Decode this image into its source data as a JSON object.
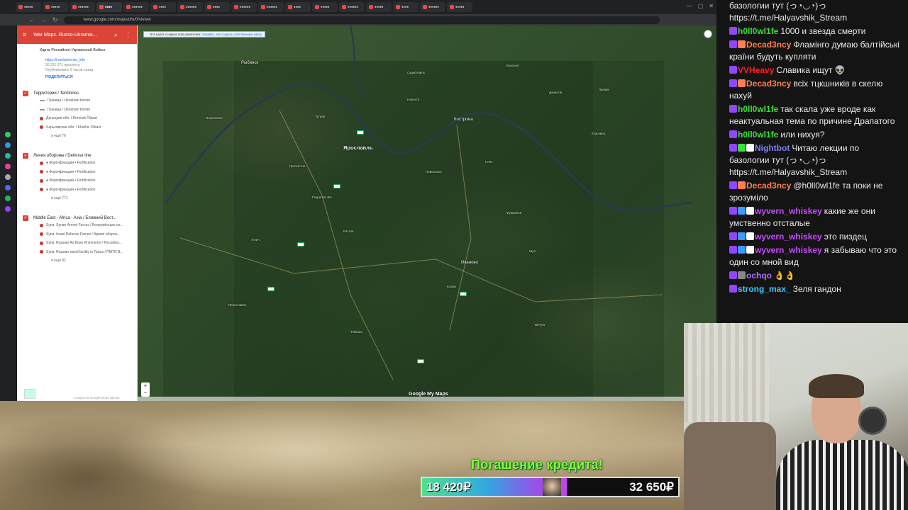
{
  "browser": {
    "tabs": [
      "▪▪▪▪▪",
      "▪▪▪▪▪",
      "▪▪▪▪▪▪",
      "▪▪▪▪",
      "▪▪▪▪▪▪",
      "▪▪▪▪",
      "▪▪▪▪▪▪",
      "▪▪▪▪",
      "▪▪▪▪▪▪",
      "▪▪▪▪▪▪",
      "▪▪▪▪",
      "▪▪▪▪▪",
      "▪▪▪▪▪▪",
      "▪▪▪▪▪",
      "▪▪▪▪",
      "▪▪▪▪▪▪",
      "▪▪▪▪▪"
    ],
    "url": "www.google.com/maps/d/u/0/viewer"
  },
  "maps_panel": {
    "title": "War Maps. Russo-Ukrainia...",
    "map_name": "Карта Российско-Украинской Войны",
    "info_link": "https://t.me/pshenka_info",
    "views": "30 231 071 просмотр",
    "published": "Опубликовано 9 часов назад",
    "share_label": "ПОДЕЛИТЬСЯ",
    "layers": [
      {
        "name": "Территории / Territories",
        "items": [
          "Граница / Ukrainian border",
          "Граница / Ukrainian border",
          "Донецкая обл. / Donetsk Oblast",
          "Харьковская обл. / Kharkiv Oblast"
        ],
        "more": "и ещё 70"
      },
      {
        "name": "Линия обороны / Defense line",
        "items": [
          "● Фортификация • Fortification",
          "● Фортификация • Fortification",
          "● Фортификация • Fortification",
          "● Фортификация • Fortification"
        ],
        "more": "и ещё 771"
      },
      {
        "name": "Middle East - Africa - Asia / Ближний Вост...",
        "items": [
          "Syria: Syrian Armed Forces / Вооружённые си...",
          "Syria: Israel Defense Forces / Армия оборон...",
          "Syria: Russian Air Base Khmeimim / Российск...",
          "Syria: Russian naval facility in Tartus / ПМТО В..."
        ],
        "more": "и ещё 82"
      }
    ],
    "footer": "Создано в Google Моих картах"
  },
  "map": {
    "notice_text": "Эта карта создана пользователем.",
    "notice_link": "Узнайте, как создать собственную карту",
    "cities": [
      {
        "name": "Ярославль",
        "big": true
      },
      {
        "name": "Кострома",
        "big": false
      },
      {
        "name": "Рыбинск",
        "big": false
      },
      {
        "name": "Иваново",
        "big": false
      }
    ],
    "towns": [
      "Данилов",
      "Тутаев",
      "Ростов",
      "Переславль",
      "Кохма",
      "Шуя",
      "Фурманов",
      "Нерехта",
      "Гаврилов-Ям",
      "Приволжск",
      "Плёс",
      "Вичуга",
      "Тейково",
      "Юрьевец",
      "Судиславль",
      "Красное",
      "Пречистое",
      "Любим",
      "Пошехонье",
      "Углич"
    ],
    "logo": "Google My Maps"
  },
  "chat": {
    "messages": [
      {
        "user": "",
        "color": "#ffffff",
        "text": "базологии тут (っ◔◡◔)っ https://t.me/Halyavshik_Stream",
        "badges": []
      },
      {
        "user": "h0ll0wl1fe",
        "color": "#3be03b",
        "text": "1000 и звезда смерти",
        "badges": [
          "#9147ff"
        ]
      },
      {
        "user": "Decad3ncy",
        "color": "#ff7f50",
        "text": "Фламінго думаю балтійські країни будуть купляти",
        "badges": [
          "#9147ff",
          "#ff7f50"
        ]
      },
      {
        "user": "VVHeavy",
        "color": "#ff2020",
        "text": "Славика ищут 👽",
        "badges": [
          "#9147ff"
        ]
      },
      {
        "user": "Decad3ncy",
        "color": "#ff7f50",
        "text": "всіх тцкшників в скелю нахуй",
        "badges": [
          "#9147ff",
          "#ff7f50"
        ]
      },
      {
        "user": "h0ll0wl1fe",
        "color": "#3be03b",
        "text": "так скала уже вроде как неактуальная тема по причине Драпатого",
        "badges": [
          "#9147ff"
        ]
      },
      {
        "user": "h0ll0wl1fe",
        "color": "#3be03b",
        "text": "или нихуя?",
        "badges": [
          "#9147ff"
        ]
      },
      {
        "user": "Nightbot",
        "color": "#7f7fff",
        "text": "Читаю лекции по базологии тут (っ◔◡◔)っ https://t.me/Halyavshik_Stream",
        "badges": [
          "#9147ff",
          "#3be03b",
          "#ffffff"
        ]
      },
      {
        "user": "Decad3ncy",
        "color": "#ff7f50",
        "text": "@h0ll0wl1fe та поки не зрозуміло",
        "badges": [
          "#9147ff",
          "#ff7f50"
        ]
      },
      {
        "user": "wyvern_whiskey",
        "color": "#c94bff",
        "text": "какие же они умственно отсталые",
        "badges": [
          "#9147ff",
          "#3b9bff",
          "#ffffff"
        ]
      },
      {
        "user": "wyvern_whiskey",
        "color": "#c94bff",
        "text": "это пиздец",
        "badges": [
          "#9147ff",
          "#3b9bff",
          "#ffffff"
        ]
      },
      {
        "user": "wyvern_whiskey",
        "color": "#c94bff",
        "text": "я забываю что это один со мной вид",
        "badges": [
          "#9147ff",
          "#3b9bff",
          "#ffffff"
        ]
      },
      {
        "user": "ochqo",
        "color": "#b070ff",
        "text": "👌👌",
        "badges": [
          "#9147ff",
          "#888888"
        ]
      },
      {
        "user": "strong_max_",
        "color": "#3fc8ff",
        "text": "Зеля гандон",
        "badges": [
          "#9147ff"
        ]
      }
    ]
  },
  "donation": {
    "title": "Погашение кредита!",
    "current": "18 420₽",
    "target": "32 650₽",
    "progress": 0.5642
  }
}
